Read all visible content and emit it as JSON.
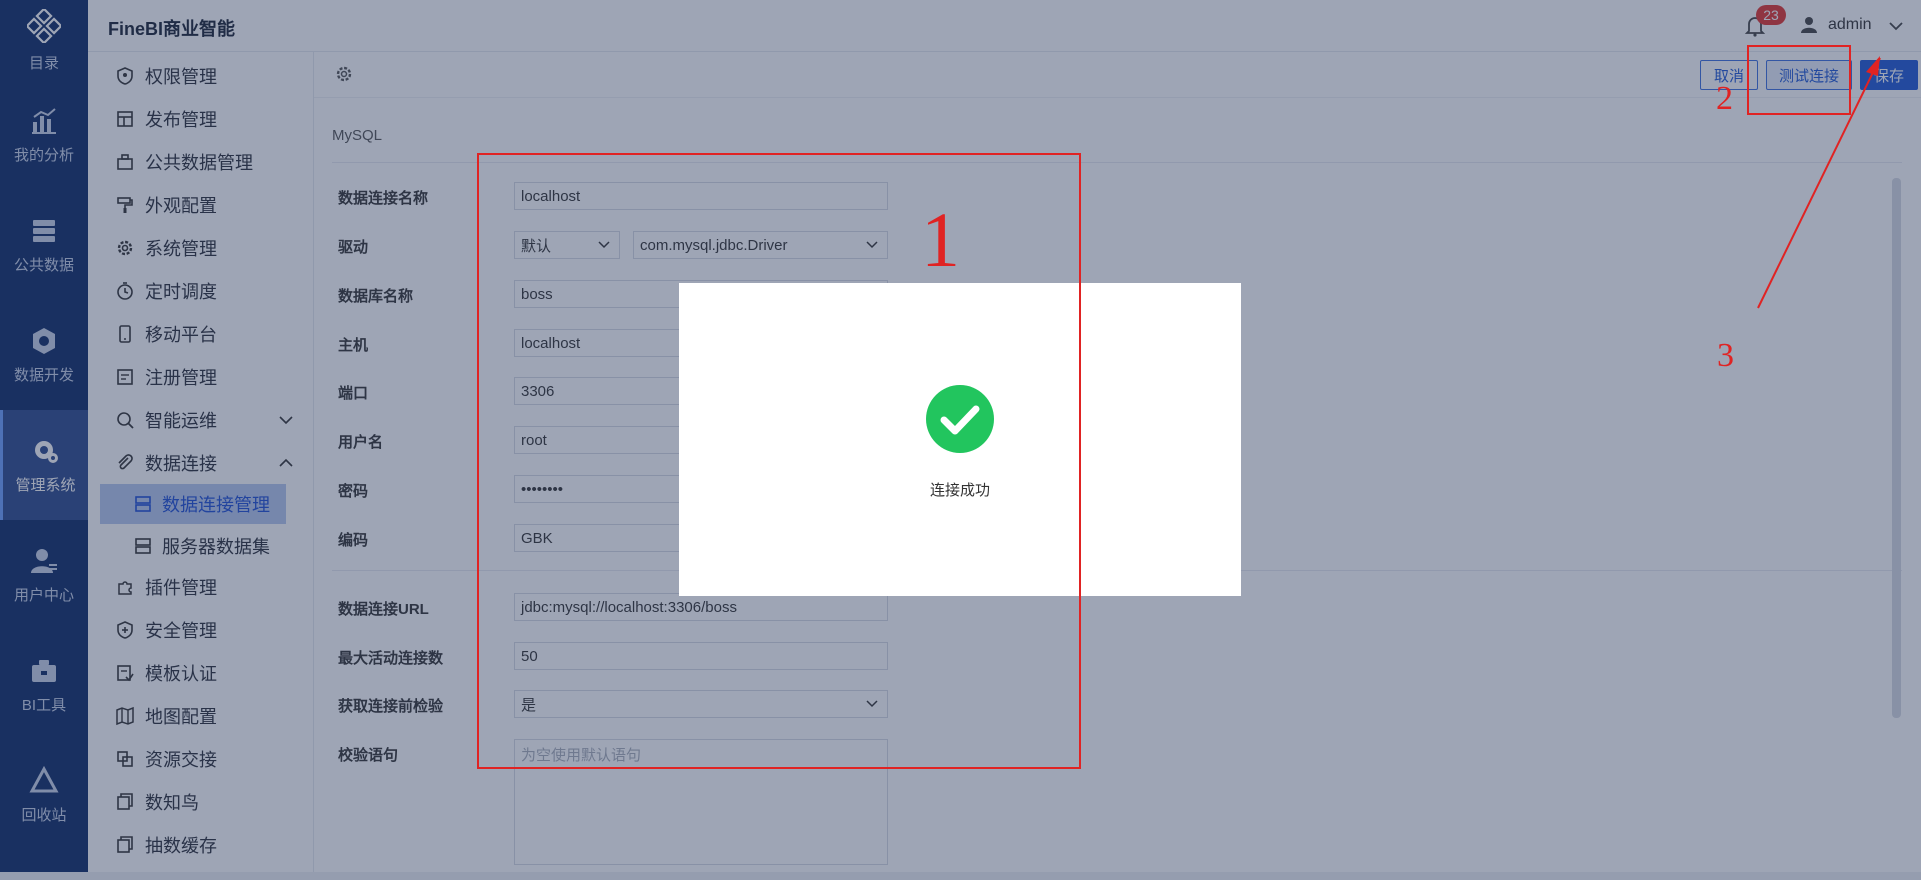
{
  "app": {
    "brand": "FineBI商业智能"
  },
  "header": {
    "notification_count": "23",
    "user_name": "admin"
  },
  "rail": {
    "items": [
      {
        "label": "目录",
        "icon": "catalog-icon"
      },
      {
        "label": "我的分析",
        "icon": "analysis-icon"
      },
      {
        "label": "公共数据",
        "icon": "public-data-icon"
      },
      {
        "label": "数据开发",
        "icon": "data-dev-icon"
      },
      {
        "label": "管理系统",
        "icon": "manage-system-icon",
        "active": true
      },
      {
        "label": "用户中心",
        "icon": "user-center-icon"
      },
      {
        "label": "BI工具",
        "icon": "bi-tools-icon"
      },
      {
        "label": "回收站",
        "icon": "recycle-bin-icon"
      }
    ]
  },
  "sidebar": {
    "items": [
      {
        "label": "权限管理"
      },
      {
        "label": "发布管理"
      },
      {
        "label": "公共数据管理"
      },
      {
        "label": "外观配置"
      },
      {
        "label": "系统管理"
      },
      {
        "label": "定时调度"
      },
      {
        "label": "移动平台"
      },
      {
        "label": "注册管理"
      },
      {
        "label": "智能运维"
      },
      {
        "label": "数据连接"
      },
      {
        "label": "插件管理"
      },
      {
        "label": "安全管理"
      },
      {
        "label": "模板认证"
      },
      {
        "label": "地图配置"
      },
      {
        "label": "资源交接"
      },
      {
        "label": "数知鸟"
      },
      {
        "label": "抽数缓存"
      }
    ],
    "sub_items": [
      {
        "label": "数据连接管理",
        "active": true
      },
      {
        "label": "服务器数据集"
      }
    ]
  },
  "toolbar": {
    "cancel_label": "取消",
    "test_label": "测试连接",
    "save_label": "保存"
  },
  "form": {
    "db_type": "MySQL",
    "labels": {
      "name": "数据连接名称",
      "driver": "驱动",
      "database": "数据库名称",
      "host": "主机",
      "port": "端口",
      "username": "用户名",
      "password": "密码",
      "encoding": "编码",
      "url": "数据连接URL",
      "max_active": "最大活动连接数",
      "validate_before": "获取连接前检验",
      "validation_query": "校验语句"
    },
    "values": {
      "name": "localhost",
      "driver_mode": "默认",
      "driver_class": "com.mysql.jdbc.Driver",
      "database": "boss",
      "host": "localhost",
      "port": "3306",
      "username": "root",
      "password": "••••••••",
      "encoding": "GBK",
      "url": "jdbc:mysql://localhost:3306/boss",
      "max_active": "50",
      "validate_before": "是"
    },
    "placeholders": {
      "validation_query": "为空使用默认语句"
    }
  },
  "modal": {
    "message": "连接成功"
  },
  "annotations": {
    "n1": "1",
    "n2": "2",
    "n3": "3"
  },
  "colors": {
    "primary": "#1f58d6",
    "rail_bg": "#0d2a66",
    "success": "#22c55e",
    "annotation": "#e02323"
  }
}
